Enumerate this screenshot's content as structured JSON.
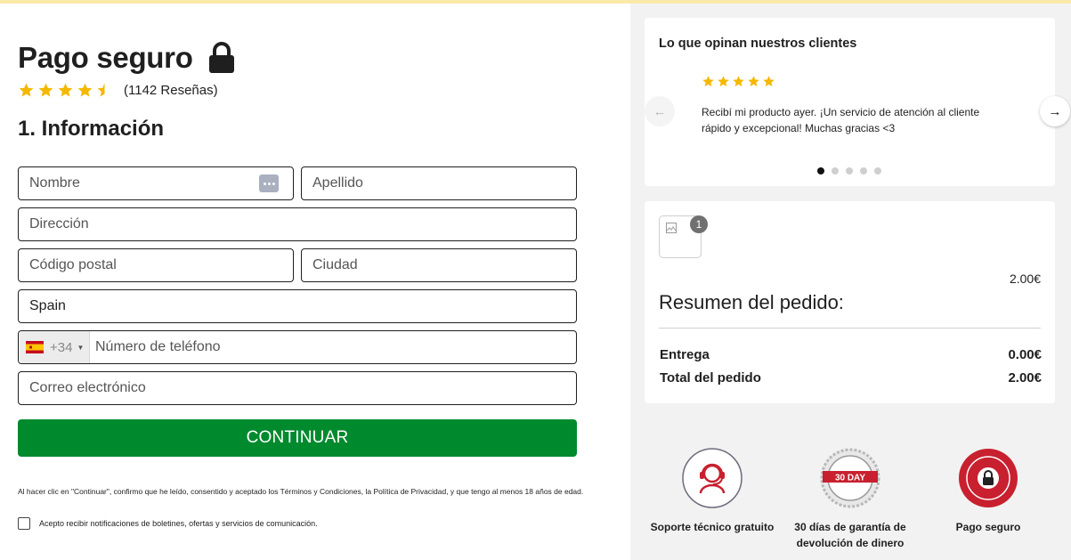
{
  "checkout": {
    "title": "Pago seguro",
    "rating": {
      "stars": 4.5,
      "count_text": "(1142 Reseñas)"
    },
    "section_title": "1. Información",
    "fields": {
      "first_name_placeholder": "Nombre",
      "last_name_placeholder": "Apellido",
      "address_placeholder": "Dirección",
      "postal_code_placeholder": "Código postal",
      "city_placeholder": "Ciudad",
      "country_value": "Spain",
      "phone_dial_code": "+34",
      "phone_placeholder": "Número de teléfono",
      "email_placeholder": "Correo electrónico"
    },
    "continue_label": "CONTINUAR",
    "legal_text": "Al hacer clic en \"Continuar\", confirmo que he leído, consentido y aceptado los Términos y Condiciones, la Política de Privacidad, y que tengo al menos 18 años de edad.",
    "consent_label": "Acepto recibir notificaciones de boletines, ofertas y servicios de comunicación."
  },
  "reviews": {
    "title": "Lo que opinan nuestros clientes",
    "current": {
      "stars": 5,
      "text": "Recibí mi producto ayer. ¡Un servicio de atención al cliente rápido y excepcional! Muchas gracias <3"
    },
    "total_slides": 5,
    "active_slide": 1
  },
  "order": {
    "item_quantity": "1",
    "item_price": "2.00€",
    "summary_title": "Resumen del pedido:",
    "delivery_label": "Entrega",
    "delivery_value": "0.00€",
    "total_label": "Total del pedido",
    "total_value": "2.00€"
  },
  "trust_badges": {
    "support_label": "Soporte técnico gratuito",
    "guarantee_label": "30 días de garantía de devolución de dinero",
    "guarantee_seal_text": "30 DAY",
    "secure_label": "Pago seguro"
  },
  "colors": {
    "accent_green": "#008a2e",
    "star_yellow": "#f5b800",
    "seal_red": "#c8202f"
  }
}
